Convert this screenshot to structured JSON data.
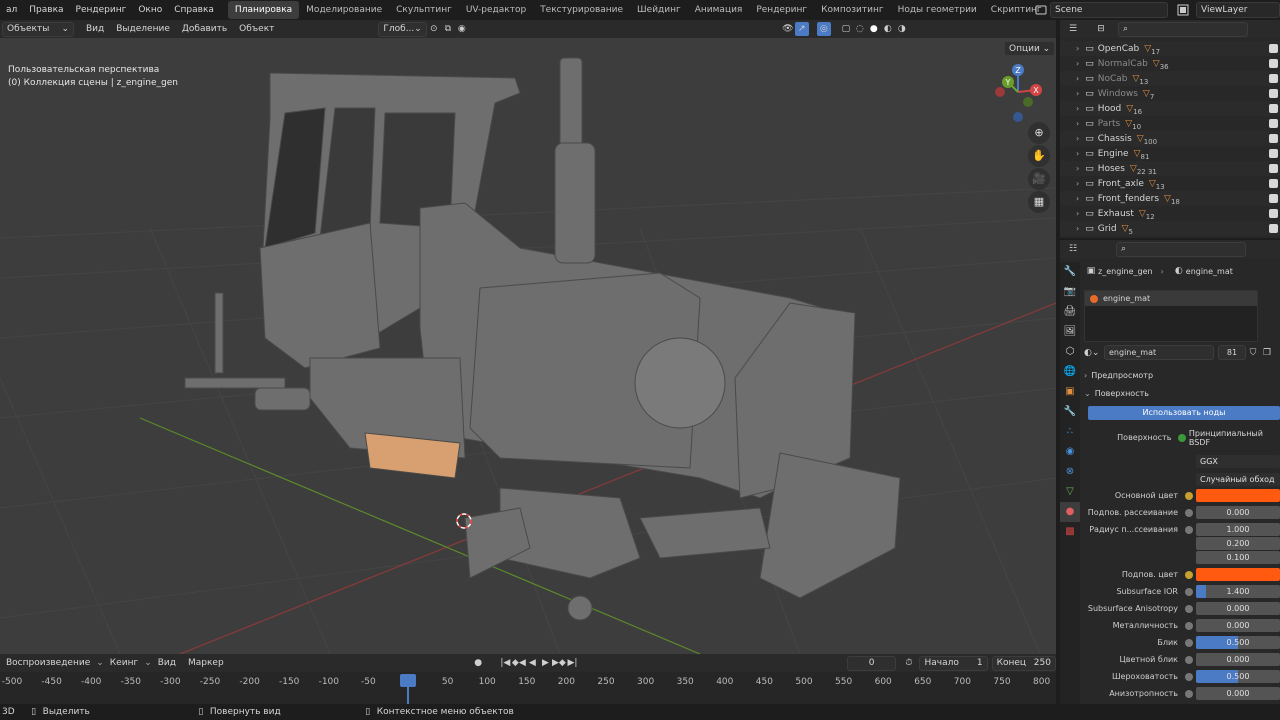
{
  "topbar": {
    "menus": [
      "Файл",
      "Правка",
      "Рендеринг",
      "Окно",
      "Справка"
    ],
    "menu_first_visible": "ал",
    "workspaces": [
      "Планировка",
      "Моделирование",
      "Скульптинг",
      "UV-редактор",
      "Текстурирование",
      "Шейдинг",
      "Анимация",
      "Рендеринг",
      "Композитинг",
      "Ноды геометрии",
      "Скриптинг"
    ],
    "active_workspace": "Планировка",
    "add_tab": "+",
    "scene": "Scene",
    "view_layer": "ViewLayer"
  },
  "viewport_header": {
    "mode": "Объекты",
    "menus": [
      "Вид",
      "Выделение",
      "Добавить",
      "Объект"
    ],
    "transform": "Глоб...",
    "options": "Опции"
  },
  "viewport": {
    "perspective": "Пользовательская перспектива",
    "collection": "(0) Коллекция сцены | z_engine_gen",
    "gizmo": {
      "x": "X",
      "y": "Y",
      "z": "Z"
    }
  },
  "timeline": {
    "menus": [
      "Воспроизведение",
      "Кеинг",
      "Вид",
      "Маркер"
    ],
    "current_frame": "0",
    "start_label": "Начало",
    "start": "1",
    "end_label": "Конец",
    "end": "250",
    "ticks": [
      "-500",
      "-450",
      "-400",
      "-350",
      "-300",
      "-250",
      "-200",
      "-150",
      "-100",
      "-50",
      "0",
      "50",
      "100",
      "150",
      "200",
      "250",
      "300",
      "350",
      "400",
      "450",
      "500",
      "550",
      "600",
      "650",
      "700",
      "750",
      "800"
    ]
  },
  "statusbar": {
    "editor": "3D",
    "select": "Выделить",
    "rotate": "Повернуть вид",
    "context": "Контекстное меню объектов"
  },
  "outliner": {
    "rows": [
      {
        "name": "OpenCab",
        "count": "17",
        "dim": false
      },
      {
        "name": "NormalCab",
        "count": "36",
        "dim": true
      },
      {
        "name": "NoCab",
        "count": "13",
        "dim": true
      },
      {
        "name": "Windows",
        "count": "7",
        "dim": true
      },
      {
        "name": "Hood",
        "count": "16",
        "dim": false
      },
      {
        "name": "Parts",
        "count": "10",
        "dim": true
      },
      {
        "name": "Chassis",
        "count": "100",
        "dim": false
      },
      {
        "name": "Engine",
        "count": "81",
        "dim": false
      },
      {
        "name": "Hoses",
        "count": "22 31",
        "dim": false
      },
      {
        "name": "Front_axle",
        "count": "13",
        "dim": false
      },
      {
        "name": "Front_fenders",
        "count": "18",
        "dim": false
      },
      {
        "name": "Exhaust",
        "count": "12",
        "dim": false
      },
      {
        "name": "Grid",
        "count": "5",
        "dim": false
      }
    ]
  },
  "properties": {
    "breadcrumb_object": "z_engine_gen",
    "breadcrumb_material": "engine_mat",
    "slot": "engine_mat",
    "material_name": "engine_mat",
    "users": "81",
    "preview": "Предпросмотр",
    "surface": "Поверхность",
    "use_nodes": "Использовать ноды",
    "shader_label": "Поверхность",
    "shader": "Принципиальный BSDF",
    "distribution": "GGX",
    "sss_method": "Случайный обход",
    "fields": [
      {
        "label": "Основной цвет",
        "value": "",
        "color": "#ff5a10",
        "fill": 0
      },
      {
        "label": "Подпов. рассеивание",
        "value": "0.000",
        "fill": 0
      },
      {
        "label": "Радиус п...ссеивания",
        "value": "1.000",
        "fill": 0
      },
      {
        "label": "",
        "value": "0.200",
        "fill": 0
      },
      {
        "label": "",
        "value": "0.100",
        "fill": 0
      },
      {
        "label": "Подпов. цвет",
        "value": "",
        "color": "#ff5a10",
        "fill": 0
      },
      {
        "label": "Subsurface IOR",
        "value": "1.400",
        "fill": 0.12
      },
      {
        "label": "Subsurface Anisotropy",
        "value": "0.000",
        "fill": 0
      },
      {
        "label": "Металличность",
        "value": "0.000",
        "fill": 0
      },
      {
        "label": "Блик",
        "value": "0.500",
        "fill": 0.5
      },
      {
        "label": "Цветной блик",
        "value": "0.000",
        "fill": 0
      },
      {
        "label": "Шероховатость",
        "value": "0.500",
        "fill": 0.5
      },
      {
        "label": "Анизотропность",
        "value": "0.000",
        "fill": 0
      }
    ]
  }
}
